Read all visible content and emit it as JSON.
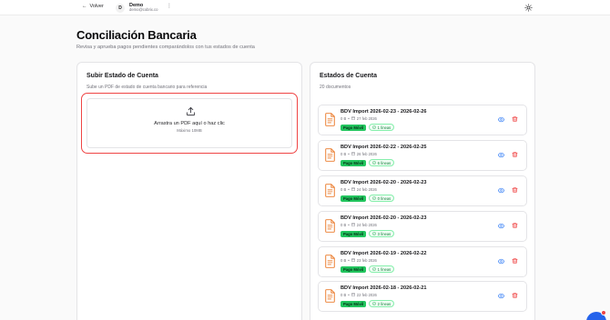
{
  "topbar": {
    "back_label": "Volver",
    "avatar_initial": "D",
    "user_name": "Demo",
    "user_email": "demo@cobrix.co",
    "menu_glyph": "⋮"
  },
  "page": {
    "title": "Conciliación Bancaria",
    "subtitle": "Revisa y aprueba pagos pendientes comparándolos con tus estados de cuenta"
  },
  "upload": {
    "title": "Subir Estado de Cuenta",
    "description": "Sube un PDF de estado de cuenta bancario para referencia",
    "drop_text": "Arrastra un PDF aquí o haz clic",
    "drop_subtext": "Máximo 10MB"
  },
  "statements": {
    "title": "Estados de Cuenta",
    "count_label": "20 documentos",
    "items": [
      {
        "title": "BDV Import 2026-02-23 - 2026-02-26",
        "size": "0 B",
        "date": "27 feb 2026",
        "method": "Pago Móvil",
        "lines": "1 líneas"
      },
      {
        "title": "BDV Import 2026-02-22 - 2026-02-25",
        "size": "0 B",
        "date": "26 feb 2026",
        "method": "Pago Móvil",
        "lines": "6 líneas"
      },
      {
        "title": "BDV Import 2026-02-20 - 2026-02-23",
        "size": "0 B",
        "date": "24 feb 2026",
        "method": "Pago Móvil",
        "lines": "0 líneas"
      },
      {
        "title": "BDV Import 2026-02-20 - 2026-02-23",
        "size": "0 B",
        "date": "24 feb 2026",
        "method": "Pago Móvil",
        "lines": "3 líneas"
      },
      {
        "title": "BDV Import 2026-02-19 - 2026-02-22",
        "size": "0 B",
        "date": "23 feb 2026",
        "method": "Pago Móvil",
        "lines": "1 líneas"
      },
      {
        "title": "BDV Import 2026-02-18 - 2026-02-21",
        "size": "0 B",
        "date": "22 feb 2026",
        "method": "Pago Móvil",
        "lines": "2 líneas"
      }
    ]
  },
  "colors": {
    "accent_orange": "#ea7a2a",
    "danger": "#ef4444",
    "success": "#22c55e",
    "info": "#3b82f6"
  },
  "icons": {
    "back": "arrow-left-icon",
    "theme": "sun-icon",
    "upload": "upload-icon",
    "document": "file-text-icon",
    "view": "eye-icon",
    "delete": "trash-icon",
    "lines": "check-circle-icon",
    "date": "calendar-icon"
  }
}
